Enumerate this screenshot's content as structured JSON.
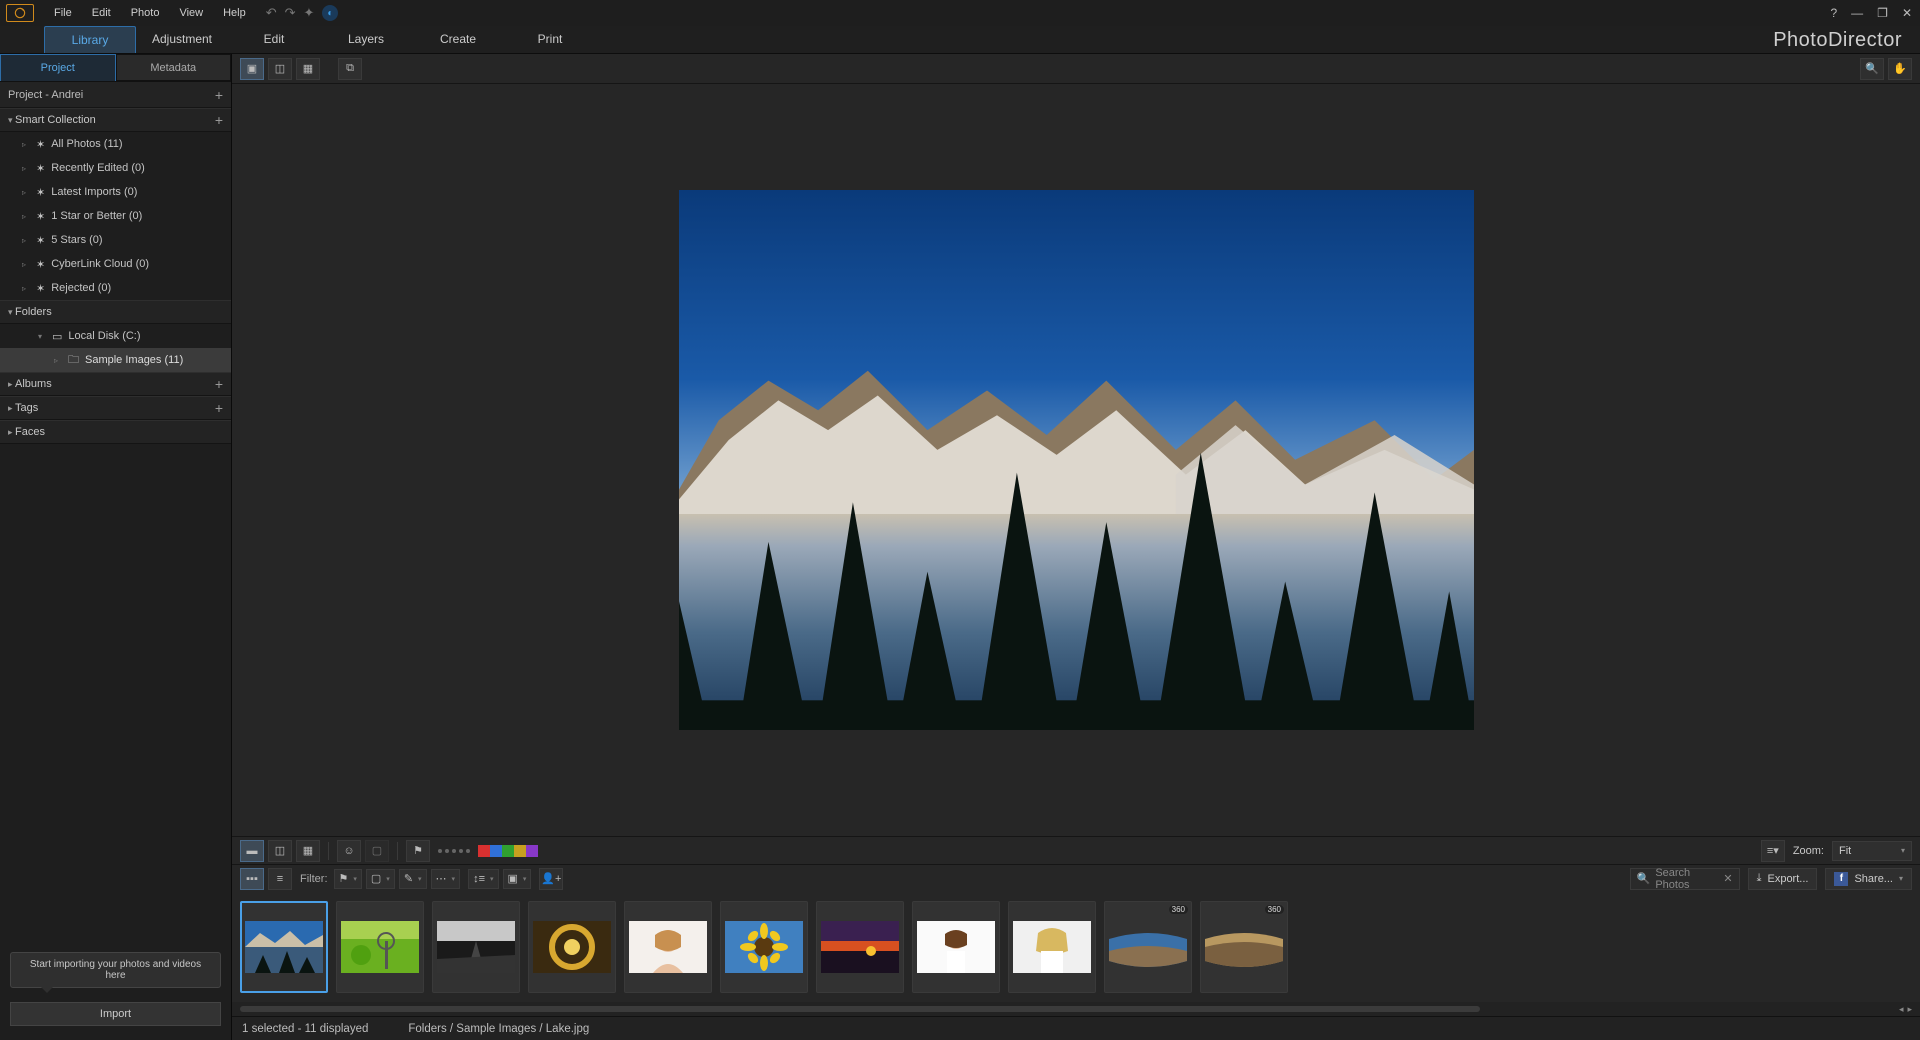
{
  "menu": {
    "items": [
      "File",
      "Edit",
      "Photo",
      "View",
      "Help"
    ]
  },
  "maintabs": {
    "items": [
      "Library",
      "Adjustment",
      "Edit",
      "Layers",
      "Create",
      "Print"
    ],
    "active": 0
  },
  "brand": "PhotoDirector",
  "subtabs": {
    "items": [
      "Project",
      "Metadata"
    ],
    "active": 0
  },
  "project_label": "Project - Andrei",
  "sections": {
    "smart": {
      "title": "Smart Collection",
      "items": [
        "All Photos (11)",
        "Recently Edited (0)",
        "Latest Imports (0)",
        "1 Star or Better (0)",
        "5 Stars (0)",
        "CyberLink Cloud (0)",
        "Rejected (0)"
      ]
    },
    "folders": {
      "title": "Folders",
      "disk": "Local Disk (C:)",
      "child": "Sample Images (11)"
    },
    "albums": "Albums",
    "tags": "Tags",
    "faces": "Faces"
  },
  "tooltip": "Start importing your photos and videos here",
  "import_btn": "Import",
  "toolbar_top": {
    "zoom_label": "Zoom:",
    "zoom_value": "Fit"
  },
  "filterbar": {
    "label": "Filter:",
    "search_placeholder": "Search Photos",
    "export": "Export...",
    "share": "Share..."
  },
  "swatches": [
    "#d83030",
    "#3070d8",
    "#30a030",
    "#c8a020",
    "#8838c8"
  ],
  "thumbs": [
    {
      "name": "Lake",
      "badge": null,
      "sel": true
    },
    {
      "name": "Meadow",
      "badge": null,
      "sel": false
    },
    {
      "name": "Pier",
      "badge": null,
      "sel": false
    },
    {
      "name": "Spiral",
      "badge": null,
      "sel": false
    },
    {
      "name": "Woman1",
      "badge": null,
      "sel": false
    },
    {
      "name": "Sunflower",
      "badge": null,
      "sel": false
    },
    {
      "name": "Sunset",
      "badge": null,
      "sel": false
    },
    {
      "name": "Woman2",
      "badge": null,
      "sel": false
    },
    {
      "name": "Woman3",
      "badge": null,
      "sel": false
    },
    {
      "name": "Pano1",
      "badge": "360",
      "sel": false
    },
    {
      "name": "Pano2",
      "badge": "360",
      "sel": false
    }
  ],
  "status": {
    "selection": "1 selected - 11 displayed",
    "path": "Folders / Sample Images / Lake.jpg"
  }
}
